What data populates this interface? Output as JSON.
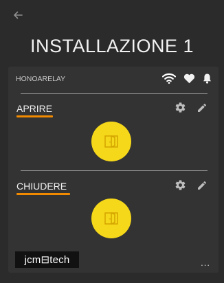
{
  "header": {
    "title": "INSTALLAZIONE 1",
    "back_icon": "arrow-left-icon"
  },
  "device": {
    "name": "HONOARELAY",
    "status_icons": [
      "wifi-icon",
      "heart-icon",
      "bell-icon"
    ]
  },
  "actions": [
    {
      "label": "APRIRE",
      "button_icon": "door-icon"
    },
    {
      "label": "CHIUDERE",
      "button_icon": "door-icon"
    }
  ],
  "footer": {
    "logo_text": "jcm⊟tech",
    "more_label": "..."
  },
  "colors": {
    "background": "#2b2b2b",
    "card": "#333333",
    "accent_underline": "#f28a00",
    "button_yellow": "#f6d81a"
  }
}
